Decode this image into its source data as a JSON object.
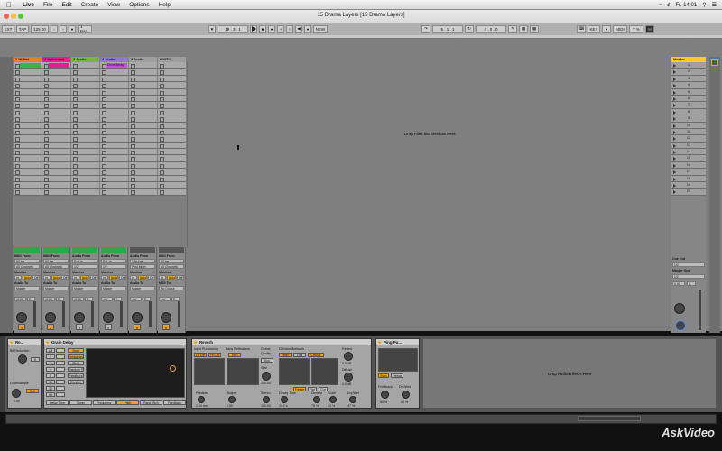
{
  "menubar": {
    "apple_icon": "apple-icon",
    "items": [
      "Live",
      "File",
      "Edit",
      "Create",
      "View",
      "Options",
      "Help"
    ],
    "clock": "Fr. 14:01"
  },
  "window": {
    "title": "15 Drama Layers  [15 Drama Layers]"
  },
  "control_bar": {
    "ext": "EXT",
    "tap": "TAP",
    "tempo": "125.00",
    "bar": "1 Bar",
    "position": "19 .  3 .  1",
    "loop_start": "5 .  1 .  1",
    "loop_length": "4 .  0 .  0",
    "key": "KEY",
    "midi": "MIDI",
    "cpu": "7 %",
    "new_label": "NEW"
  },
  "tracks": [
    {
      "name": "1 Hi-Hat",
      "color": "#e67e22",
      "clip": "",
      "clip_color": "#3bb34a",
      "num": "1",
      "vol": "-5.90",
      "pan": "C",
      "io_from": "All Ins",
      "io_chan": "All Channels",
      "mon_in": "In",
      "mon_auto": "Auto",
      "mon_off": "Off",
      "out": "Master"
    },
    {
      "name": "2 Instrumnt",
      "color": "#e91e8c",
      "clip": "",
      "clip_color": "#e91e8c",
      "num": "2",
      "vol": "-5.90",
      "pan": "C",
      "io_from": "All Ins",
      "io_chan": "All Channels",
      "mon_in": "In",
      "mon_auto": "Auto",
      "mon_off": "Off",
      "out": "Master"
    },
    {
      "name": "3 Audio",
      "color": "#7cb342",
      "clip": "",
      "clip_color": "#a9a9a9",
      "num": "3",
      "vol": "-5.90",
      "pan": "C",
      "io_from": "Ext. In",
      "io_chan": "1/2",
      "mon_in": "In",
      "mon_auto": "Auto",
      "mon_off": "Off",
      "out": "Master"
    },
    {
      "name": "4 Audio",
      "color": "#9575cd",
      "clip": "Drum Array",
      "clip_color": "#c052e0",
      "num": "4",
      "vol": "-inf",
      "pan": "C",
      "io_from": "Ext. In",
      "io_chan": "1/2",
      "mon_in": "In",
      "mon_auto": "Auto",
      "mon_off": "Off",
      "out": "Master"
    },
    {
      "name": "5 Audio",
      "color": "#9e9e9e",
      "clip": "",
      "clip_color": "#a9a9a9",
      "num": "5",
      "vol": "-inf",
      "pan": "C",
      "io_from": "1 Hi-Hat",
      "io_chan": "Post Mixer",
      "mon_in": "In",
      "mon_auto": "Auto",
      "mon_off": "Off",
      "out": "Master"
    },
    {
      "name": "6 MIDI",
      "color": "#9e9e9e",
      "clip": "",
      "clip_color": "#a9a9a9",
      "num": "6",
      "vol": "-inf",
      "pan": "C",
      "io_from": "All Ins",
      "io_chan": "All Channels",
      "mon_in": "In",
      "mon_auto": "Auto",
      "mon_off": "Off",
      "out": "No Output"
    }
  ],
  "mixer_labels": {
    "midi_from": "MIDI From",
    "audio_from": "Audio From",
    "monitor": "Monitor",
    "audio_to": "Audio To",
    "midi_to": "MIDI To",
    "track_delay": "Track Delay",
    "delay_value": "0.00",
    "delay_unit": "ms",
    "stop": "Stop"
  },
  "session": {
    "drop_files": "Drop Files and Devices Here",
    "master_name": "Master",
    "scenes": [
      "1",
      "2",
      "3",
      "4",
      "5",
      "6",
      "7",
      "8",
      "9",
      "10",
      "11",
      "12",
      "13",
      "14",
      "15",
      "16",
      "17",
      "18",
      "19",
      "20"
    ],
    "cue_out_label": "Cue Out",
    "cue_out": "1/2",
    "master_out_label": "Master Out",
    "master_out": "1/2",
    "master_vol": "0.00",
    "master_pan": "C"
  },
  "devices": {
    "redux": {
      "title": "Re...",
      "bit_reduction": "Bit Reduction",
      "bits": "8",
      "downsample": "Downsample",
      "soft": "Soft",
      "ds_value": "1.40",
      "off": "Off"
    },
    "grain_delay": {
      "title": "Grain Delay",
      "sync": "Sync",
      "buttons": [
        "Frequency",
        "Pitch",
        "Random Pitch",
        "Feedback",
        "DryWet"
      ],
      "params": [
        "1/4",
        "1",
        "2",
        "4",
        "8",
        "16",
        "32",
        "64"
      ],
      "bottom": [
        "Delay Time",
        "Spray",
        "Frequency",
        "Pitch",
        "Rand Pitch",
        "Feedback"
      ],
      "pitch_hl": "Pitch"
    },
    "reverb": {
      "title": "Reverb",
      "input_processing": "Input Processing",
      "early_reflections": "Early Reflections",
      "global": "Global",
      "quality": "Quality",
      "diffusion_network": "Diffusion Network",
      "chorus": "Chorus",
      "reflect": "Reflect",
      "diffuse": "Diffuse",
      "lo_cut": "Lo Cut",
      "hi_cut": "Hi Cut",
      "spin": "Spin",
      "size": "Size",
      "eco": "Eco",
      "high": "High",
      "low": "Low",
      "freeze": "Freeze",
      "flat": "Flat",
      "cut": "Cut",
      "lbl_predelay": "Predelay",
      "lbl_shape": "Shape",
      "lbl_stereo": "Stereo",
      "lbl_decay": "Decay Time",
      "lbl_density": "Density",
      "lbl_scale": "Scale",
      "lbl_drywet": "Dry/Wet",
      "val_predelay": "2.50 ms",
      "val_shape": "0.50",
      "val_stereo": "100.00",
      "val_decay": "10.0 s",
      "val_density": "75 %",
      "val_scale": "40 %",
      "val_drywet": "47 %",
      "val_size": "100.00",
      "val_reflect": "0.0 dB",
      "val_diffuse": "0.0 dB"
    },
    "ping_pong": {
      "title": "Ping Po...",
      "feedback": "Feedback",
      "drywet": "Dry/Wet",
      "fb_value": "50 %",
      "dw_value": "44 %",
      "sync": "Sync",
      "freeze": "Freeze"
    },
    "drop_audio": "Drop Audio Effects Here"
  },
  "branding": {
    "watermark": "AskVideo"
  },
  "colors": {
    "accent": "#f0a21c",
    "panel": "#8a8a8a",
    "dark": "#111111"
  }
}
